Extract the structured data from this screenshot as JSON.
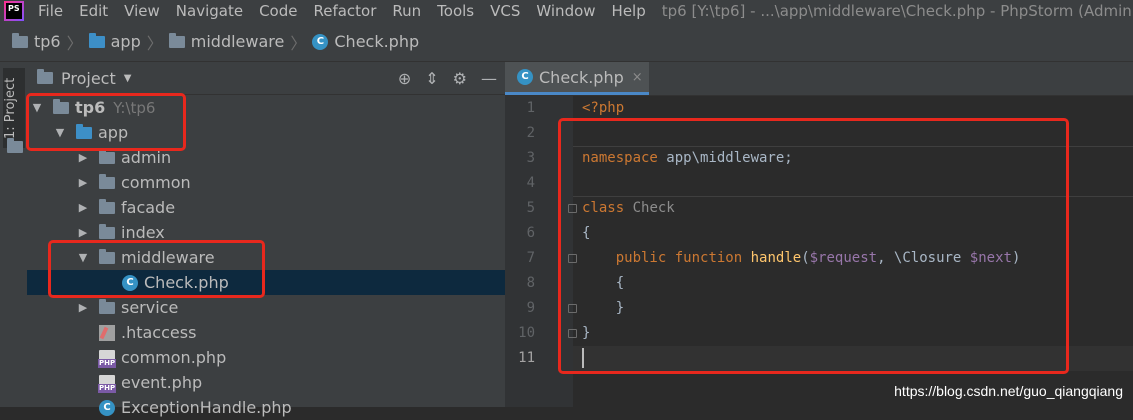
{
  "menubar": {
    "logo_text": "PS",
    "items": [
      "File",
      "Edit",
      "View",
      "Navigate",
      "Code",
      "Refactor",
      "Run",
      "Tools",
      "VCS",
      "Window",
      "Help"
    ],
    "window_title": "tp6 [Y:\\tp6] - ...\\app\\middleware\\Check.php - PhpStorm (Admini"
  },
  "breadcrumb": [
    "tp6",
    "app",
    "middleware",
    "Check.php"
  ],
  "toolstrip": {
    "project_tab": "1: Project"
  },
  "project_panel": {
    "title": "Project",
    "tree": [
      {
        "label": "tp6",
        "hint": "Y:\\tp6",
        "type": "folder-root",
        "expanded": true,
        "depth": 0
      },
      {
        "label": "app",
        "type": "folder-blue",
        "expanded": true,
        "depth": 1
      },
      {
        "label": "admin",
        "type": "folder",
        "expanded": false,
        "depth": 2
      },
      {
        "label": "common",
        "type": "folder",
        "expanded": false,
        "depth": 2
      },
      {
        "label": "facade",
        "type": "folder",
        "expanded": false,
        "depth": 2
      },
      {
        "label": "index",
        "type": "folder",
        "expanded": false,
        "depth": 2
      },
      {
        "label": "middleware",
        "type": "folder",
        "expanded": true,
        "depth": 2
      },
      {
        "label": "Check.php",
        "type": "class",
        "depth": 3,
        "selected": true
      },
      {
        "label": "service",
        "type": "folder",
        "expanded": false,
        "depth": 2
      },
      {
        "label": ".htaccess",
        "type": "htaccess",
        "depth": 2
      },
      {
        "label": "common.php",
        "type": "php",
        "depth": 2
      },
      {
        "label": "event.php",
        "type": "php",
        "depth": 2
      },
      {
        "label": "ExceptionHandle.php",
        "type": "class",
        "depth": 2
      }
    ]
  },
  "editor": {
    "tab_label": "Check.php",
    "tab_close": "×",
    "lines": [
      "1",
      "2",
      "3",
      "4",
      "5",
      "6",
      "7",
      "8",
      "9",
      "10",
      "11"
    ],
    "current_line": "11",
    "code": {
      "l1": "<?php",
      "l3_kw": "namespace",
      "l3_rest": " app\\middleware;",
      "l5_kw": "class",
      "l5_name": " Check",
      "l6": "{",
      "l7_kw1": "public",
      "l7_kw2": "function",
      "l7_fn": "handle",
      "l7_p1": "(",
      "l7_v1": "$request",
      "l7_mid": ", \\Closure ",
      "l7_v2": "$next",
      "l7_end": ")",
      "l8": "{",
      "l9": "}",
      "l10": "}"
    }
  },
  "watermark": "https://blog.csdn.net/guo_qiangqiang",
  "colors": {
    "highlight_box": "#e8281d",
    "accent": "#4a88c7"
  }
}
